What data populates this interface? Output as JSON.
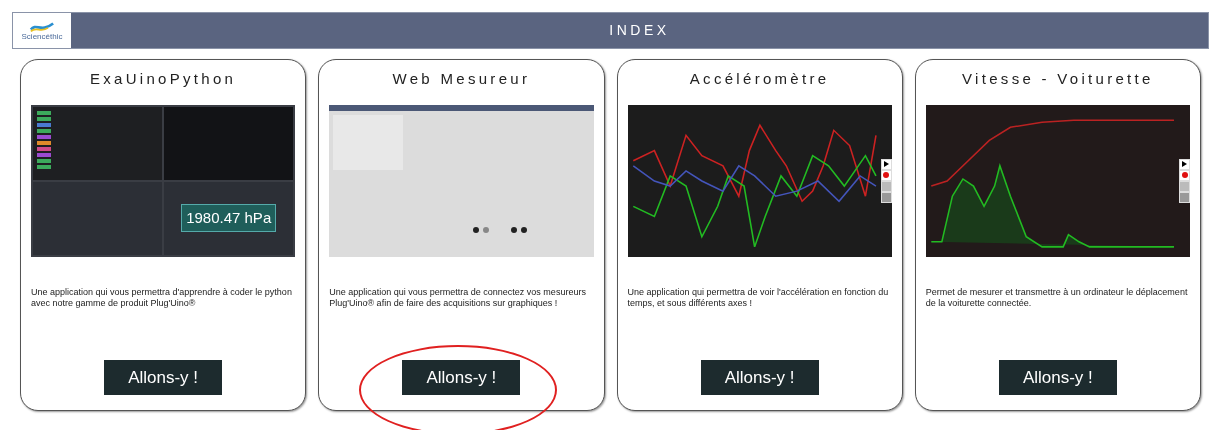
{
  "header": {
    "logo_text": "Sciencéthic",
    "title": "INDEX"
  },
  "cards": [
    {
      "title": "ExaUinoPython",
      "preview": {
        "kind": "code-editor",
        "readout": "1980.47 hPa"
      },
      "description": "Une application qui vous permettra d'apprendre à coder le python avec notre gamme de produit Plug'Uino®",
      "button": "Allons-y !",
      "circled": false
    },
    {
      "title": "Web Mesureur",
      "preview": {
        "kind": "web-gauge"
      },
      "description": "Une application qui vous permettra de connectez vos mesureurs Plug'Uino® afin de faire des acquisitions sur graphiques !",
      "button": "Allons-y !",
      "circled": true
    },
    {
      "title": "Accéléromètre",
      "preview": {
        "kind": "line-chart"
      },
      "description": "Une application qui permettra de voir l'accélération en fonction du temps, et sous différents axes !",
      "button": "Allons-y !",
      "circled": false
    },
    {
      "title": "Vitesse - Voiturette",
      "preview": {
        "kind": "speed-chart"
      },
      "description": "Permet de mesurer et transmettre à un ordinateur le déplacement de la voiturette connectée.",
      "button": "Allons-y !",
      "circled": false
    }
  ]
}
